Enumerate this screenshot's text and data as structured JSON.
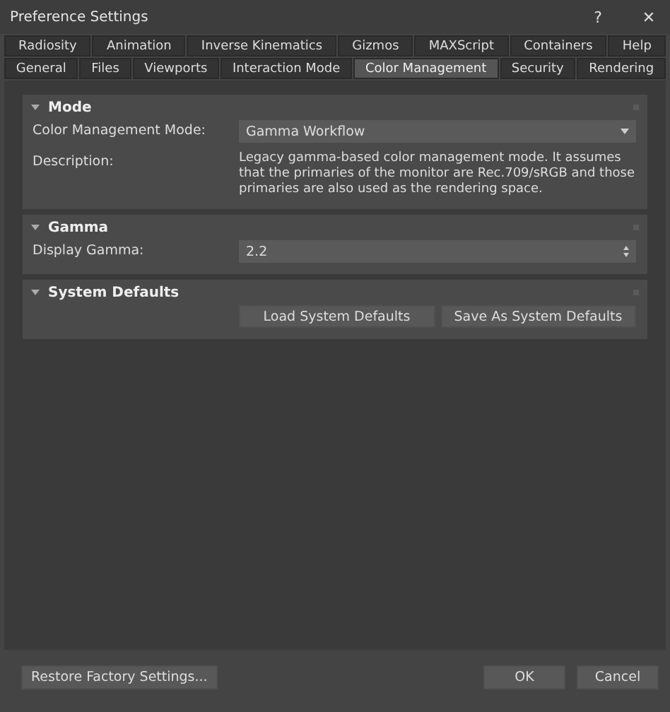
{
  "window": {
    "title": "Preference Settings",
    "help": "?",
    "close": "✕"
  },
  "tab_rows": [
    [
      {
        "label": "Radiosity",
        "selected": false
      },
      {
        "label": "Animation",
        "selected": false
      },
      {
        "label": "Inverse Kinematics",
        "selected": false
      },
      {
        "label": "Gizmos",
        "selected": false
      },
      {
        "label": "MAXScript",
        "selected": false
      },
      {
        "label": "Containers",
        "selected": false
      },
      {
        "label": "Help",
        "selected": false
      }
    ],
    [
      {
        "label": "General",
        "selected": false
      },
      {
        "label": "Files",
        "selected": false
      },
      {
        "label": "Viewports",
        "selected": false
      },
      {
        "label": "Interaction Mode",
        "selected": false
      },
      {
        "label": "Color Management",
        "selected": true
      },
      {
        "label": "Security",
        "selected": false
      },
      {
        "label": "Rendering",
        "selected": false
      }
    ]
  ],
  "sections": [
    {
      "title": "Mode",
      "expanded": true,
      "rows": [
        {
          "kind": "dropdown",
          "label": "Color Management Mode:",
          "value": "Gamma Workflow"
        },
        {
          "kind": "text",
          "label": "Description:",
          "value": "Legacy gamma-based color management mode. It assumes that the primaries of the monitor are Rec.709/sRGB and those primaries are also used as the rendering space."
        }
      ]
    },
    {
      "title": "Gamma",
      "expanded": true,
      "rows": [
        {
          "kind": "spinner",
          "label": "Display Gamma:",
          "value": "2.2"
        }
      ]
    },
    {
      "title": "System Defaults",
      "expanded": true,
      "rows": [
        {
          "kind": "buttons",
          "buttons": [
            "Load System Defaults",
            "Save As System Defaults"
          ]
        }
      ]
    }
  ],
  "footer": {
    "left_button": "Restore Factory Settings...",
    "buttons": [
      "OK",
      "Cancel"
    ]
  }
}
